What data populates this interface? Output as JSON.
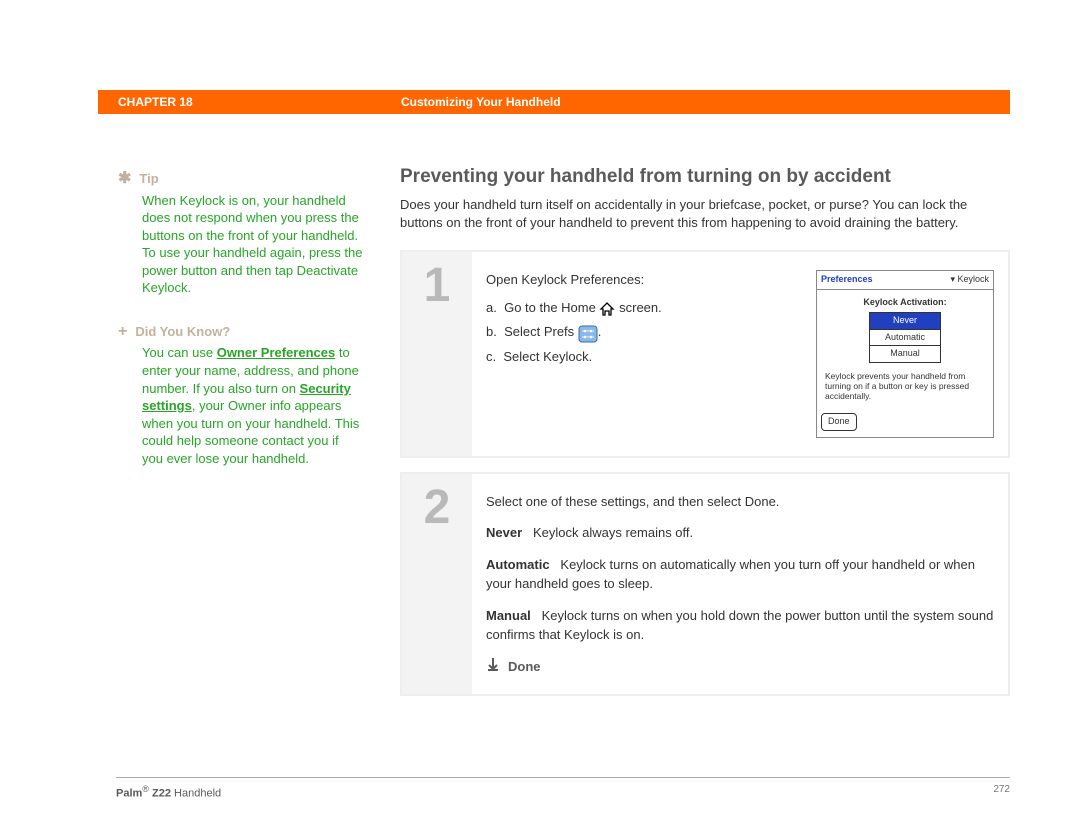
{
  "header": {
    "chapter": "CHAPTER 18",
    "title": "Customizing Your Handheld"
  },
  "sidebar": {
    "tip": {
      "label": "Tip",
      "body": "When Keylock is on, your handheld does not respond when you press the buttons on the front of your handheld. To use your handheld again, press the power button and then tap Deactivate Keylock."
    },
    "didyouknow": {
      "label": "Did You Know?",
      "p1": "You can use ",
      "link1": "Owner Preferences",
      "p2": " to enter your name, address, and phone number. If you also turn on ",
      "link2": "Security settings",
      "p3": ", your Owner info appears when you turn on your handheld. This could help someone contact you if you ever lose your handheld."
    }
  },
  "main": {
    "title": "Preventing your handheld from turning on by accident",
    "intro": "Does your handheld turn itself on accidentally in your briefcase, pocket, or purse? You can lock the buttons on the front of your handheld to prevent this from happening to avoid draining the battery."
  },
  "step1": {
    "num": "1",
    "lead": "Open Keylock Preferences:",
    "a_prefix": "a.",
    "a_text1": "Go to the Home",
    "a_text2": "screen.",
    "b_prefix": "b.",
    "b_text1": "Select Prefs",
    "b_text2": ".",
    "c_prefix": "c.",
    "c_text": "Select Keylock."
  },
  "screenshot": {
    "pref": "Preferences",
    "dropdown": "Keylock",
    "activation_label": "Keylock Activation:",
    "opt_never": "Never",
    "opt_auto": "Automatic",
    "opt_manual": "Manual",
    "note": "Keylock prevents your handheld from turning on if a button or key is pressed accidentally.",
    "done": "Done"
  },
  "step2": {
    "num": "2",
    "lead": "Select one of these settings, and then select Done.",
    "never_label": "Never",
    "never_desc": "Keylock always remains off.",
    "auto_label": "Automatic",
    "auto_desc": "Keylock turns on automatically when you turn off your handheld or when your handheld goes to sleep.",
    "manual_label": "Manual",
    "manual_desc": "Keylock turns on when you hold down the power button until the system sound confirms that Keylock is on.",
    "done": "Done"
  },
  "footer": {
    "brand": "Palm",
    "model": "Z22",
    "suffix": "Handheld",
    "page": "272"
  }
}
